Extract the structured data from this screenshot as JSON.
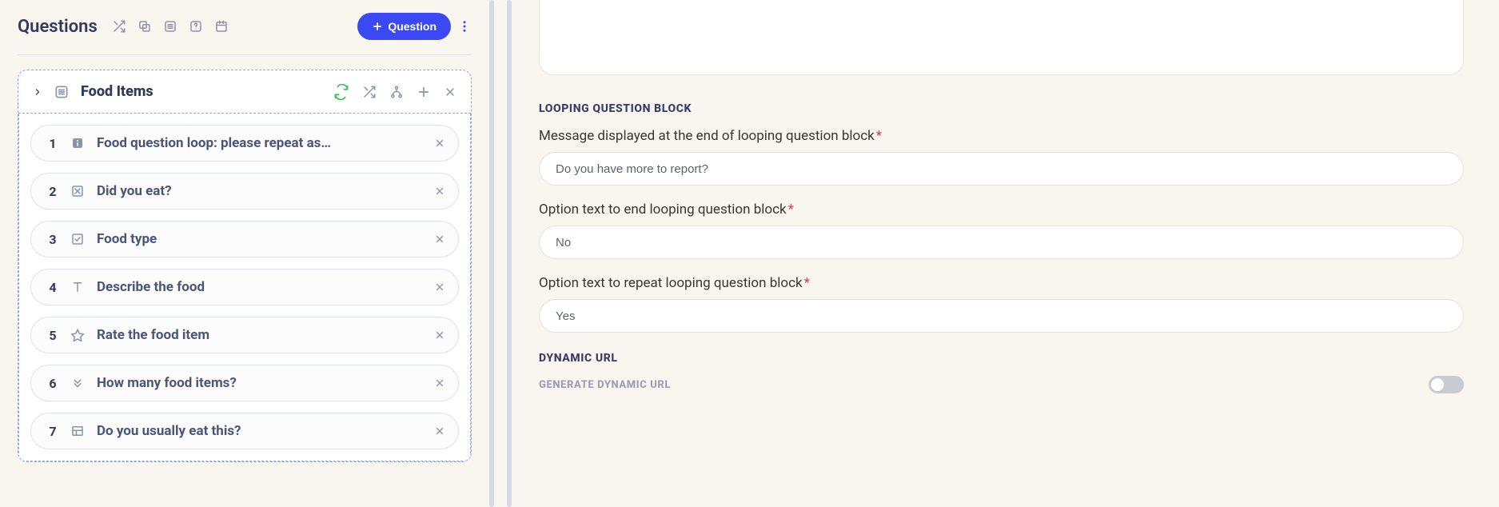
{
  "left": {
    "title": "Questions",
    "add_button": "Question",
    "group": {
      "title": "Food Items",
      "questions": [
        {
          "num": "1",
          "label": "Food question loop: please repeat as…",
          "type": "info"
        },
        {
          "num": "2",
          "label": "Did you eat?",
          "type": "single"
        },
        {
          "num": "3",
          "label": "Food type",
          "type": "multi"
        },
        {
          "num": "4",
          "label": "Describe the food",
          "type": "text"
        },
        {
          "num": "5",
          "label": "Rate the food item",
          "type": "rating"
        },
        {
          "num": "6",
          "label": "How many food items?",
          "type": "number"
        },
        {
          "num": "7",
          "label": "Do you usually eat this?",
          "type": "table"
        }
      ]
    }
  },
  "right": {
    "section1_heading": "Looping Question Block",
    "field1_label": "Message displayed at the end of looping question block",
    "field1_value": "Do you have more to report?",
    "field2_label": "Option text to end looping question block",
    "field2_value": "No",
    "field3_label": "Option text to repeat looping question block",
    "field3_value": "Yes",
    "section2_heading": "Dynamic URL",
    "toggle_label": "Generate Dynamic URL"
  }
}
